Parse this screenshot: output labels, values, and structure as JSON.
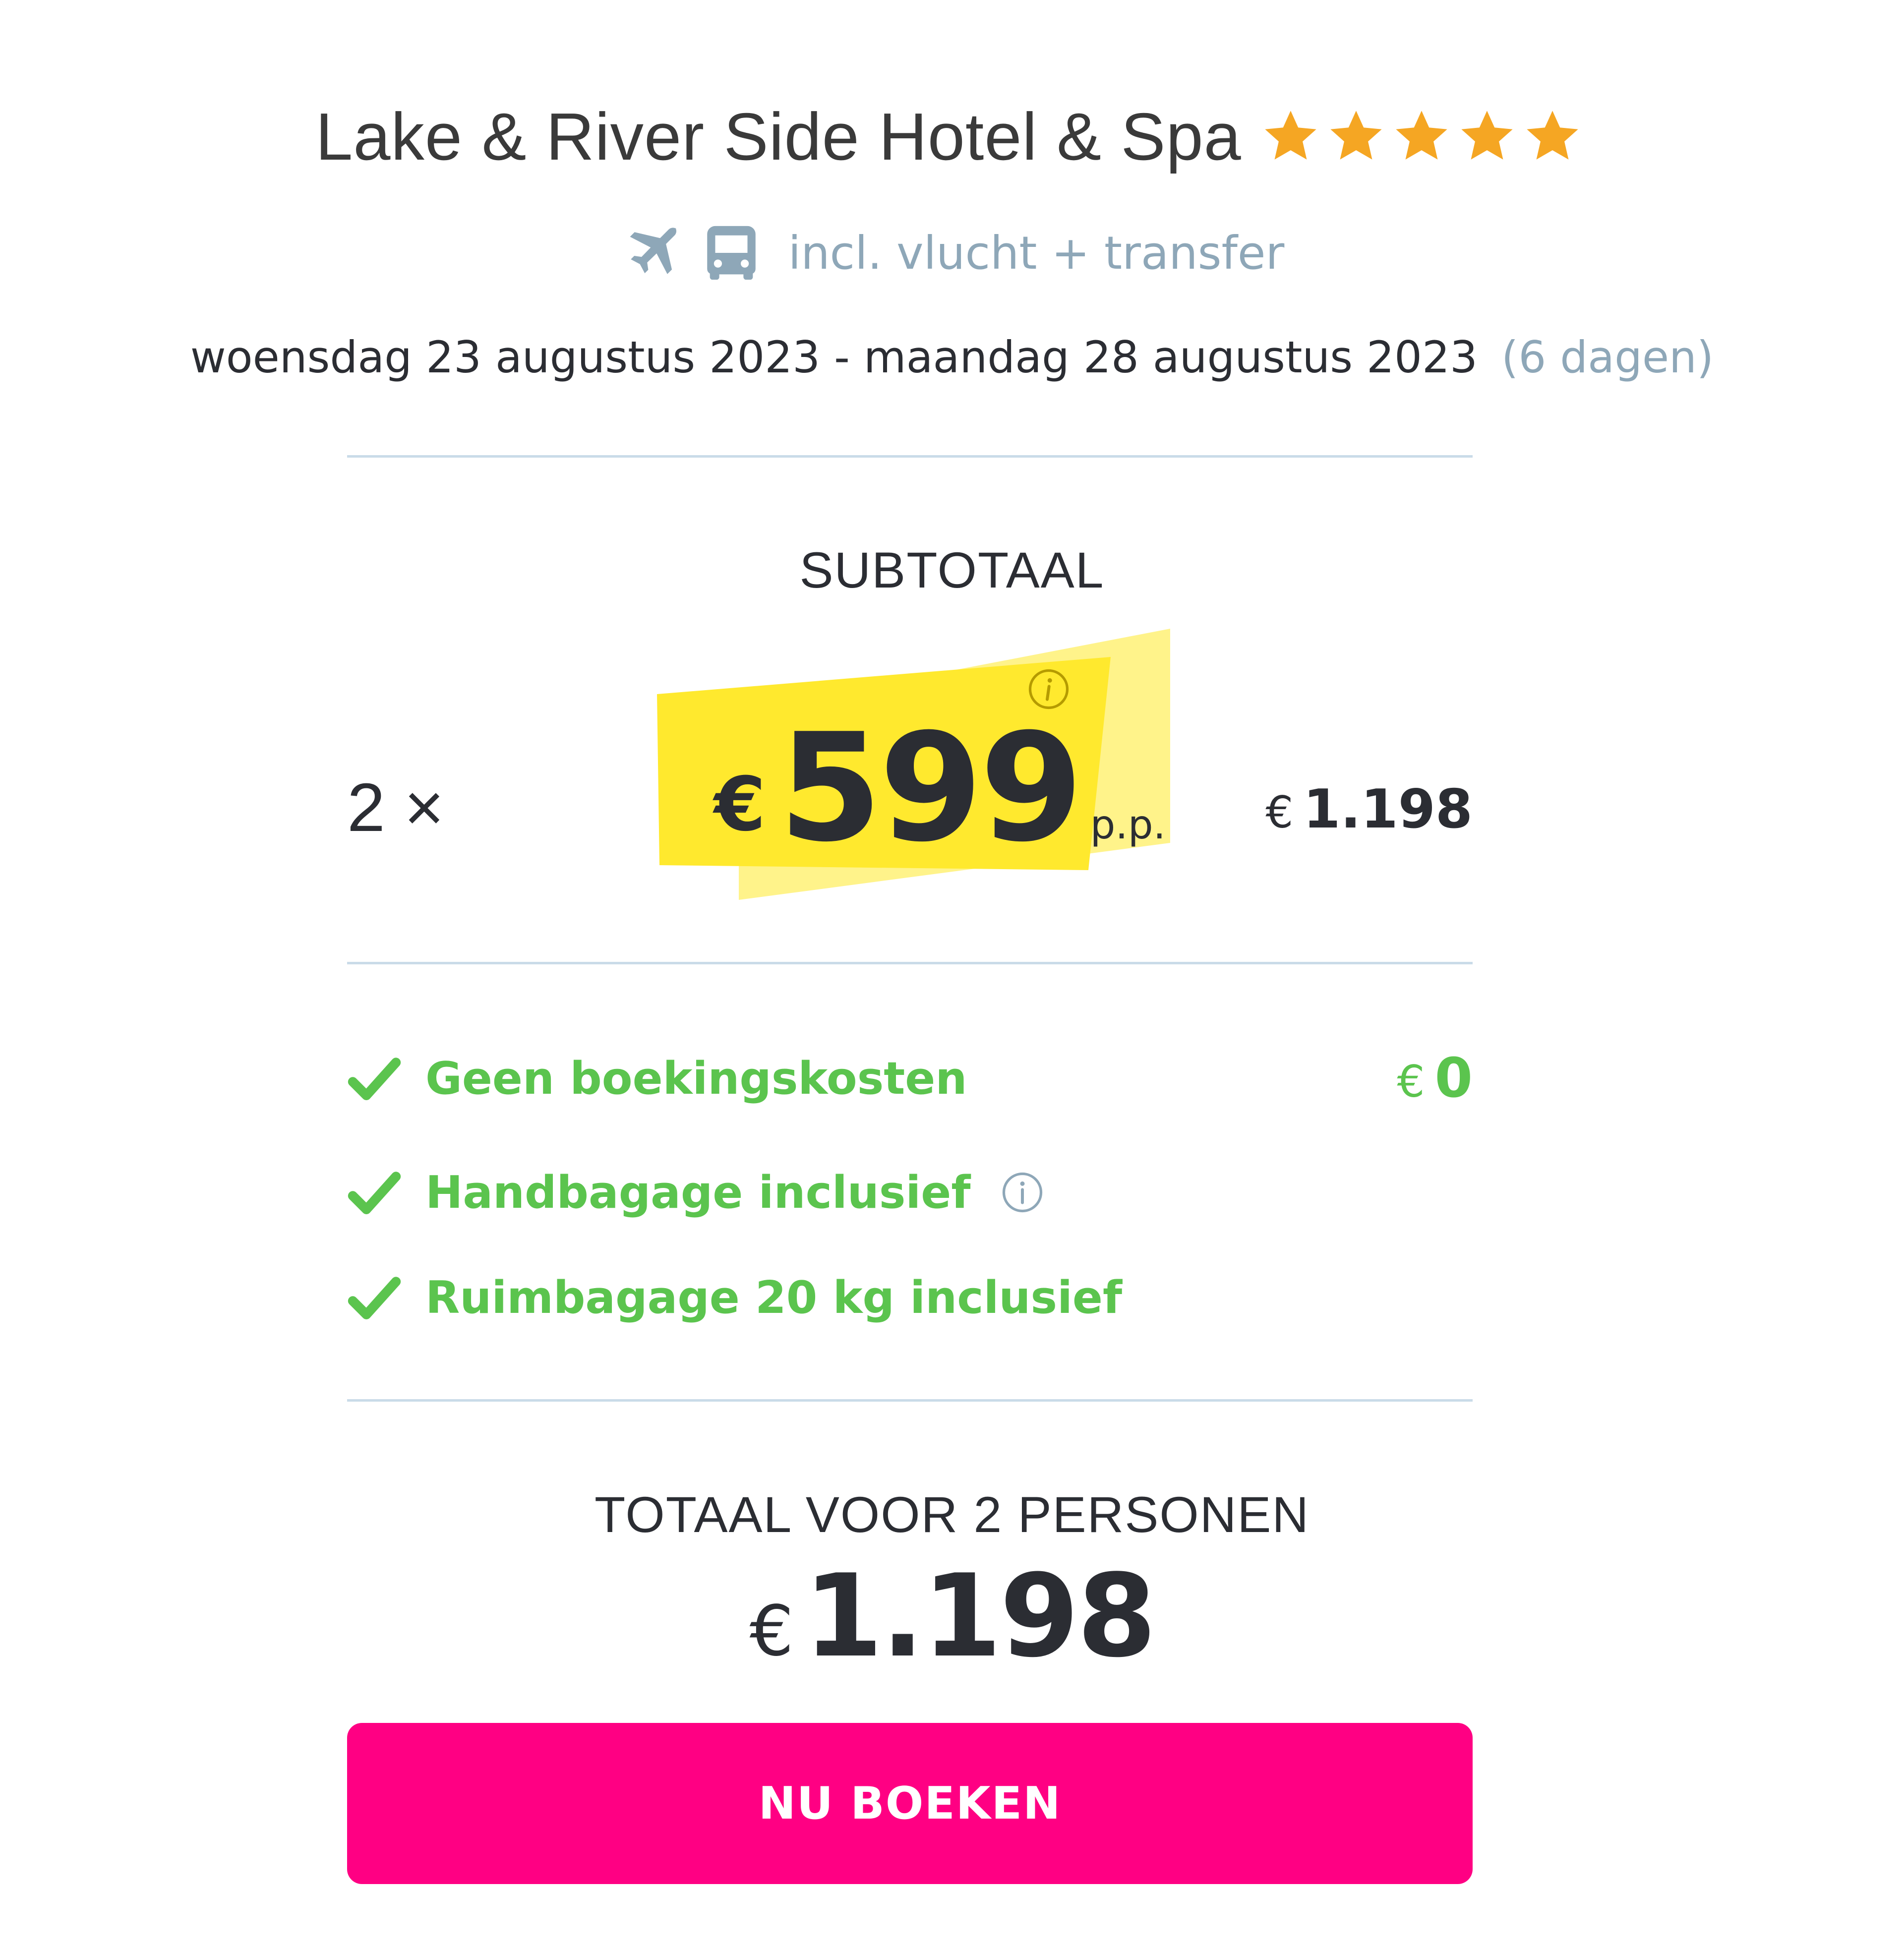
{
  "hotel": {
    "name": "Lake & River Side Hotel & Spa",
    "stars": 5
  },
  "transport": {
    "icons": [
      "plane-icon",
      "bus-icon"
    ],
    "text": "incl. vlucht + transfer"
  },
  "dates": {
    "range": "woensdag 23 augustus 2023 - maandag 28 augustus 2023",
    "duration": "(6 dagen)"
  },
  "subtotal": {
    "label": "SUBTOTAAL",
    "quantity": "2 ×",
    "currency": "€",
    "price": "599",
    "unit": "p.p.",
    "line_total_currency": "€",
    "line_total": "1.198"
  },
  "features": [
    {
      "label": "Geen boekingskosten",
      "icon": "check-icon",
      "value_currency": "€",
      "value": "0"
    },
    {
      "label": "Handbagage inclusief",
      "icon": "check-icon",
      "info": "info-icon"
    },
    {
      "label": "Ruimbagage 20 kg inclusief",
      "icon": "check-icon"
    }
  ],
  "total": {
    "label": "TOTAAL VOOR 2 PERSONEN",
    "currency": "€",
    "value": "1.198"
  },
  "cta": {
    "label": "NU BOEKEN"
  },
  "colors": {
    "star": "#f5a623",
    "muted_text": "#8ea7b8",
    "highlight": "#ffe92e",
    "highlight_light": "#fff38a",
    "success": "#5bc44e",
    "cta_bg": "#ff0083",
    "divider": "#c9dbe8",
    "text_dark": "#2b2d33"
  }
}
